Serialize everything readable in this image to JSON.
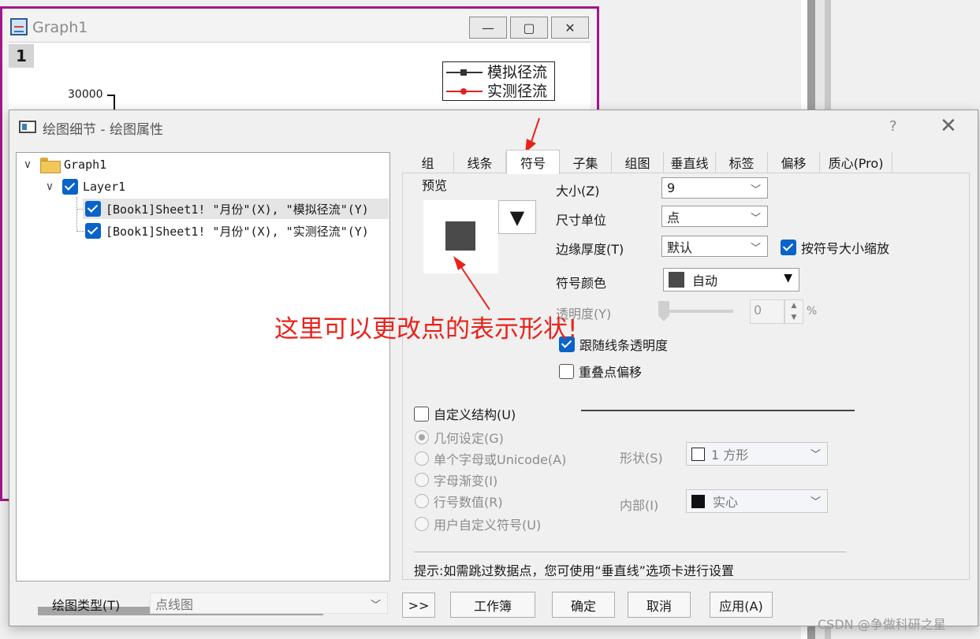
{
  "graph_window": {
    "title": "Graph1",
    "layer_badge": "1",
    "y_tick_label": "30000",
    "legend": [
      "模拟径流",
      "实测径流"
    ],
    "minimize": "—",
    "maximize": "▢",
    "close": "✕"
  },
  "dialog": {
    "title": "绘图细节 - 绘图属性",
    "help": "?",
    "close": "✕",
    "tree": {
      "graph": "Graph1",
      "layer": "Layer1",
      "series": [
        "[Book1]Sheet1! \"月份\"(X), \"模拟径流\"(Y)",
        "[Book1]Sheet1! \"月份\"(X), \"实测径流\"(Y)"
      ]
    },
    "tabs": [
      "组",
      "线条",
      "符号",
      "子集",
      "组图",
      "垂直线",
      "标签",
      "偏移",
      "质心(Pro)"
    ],
    "active_tab": "符号",
    "symbol": {
      "preview_label": "预览",
      "size_label": "大小(Z)",
      "size_value": "9",
      "unit_label": "尺寸单位",
      "unit_value": "点",
      "edge_label": "边缘厚度(T)",
      "edge_value": "默认",
      "scale_checkbox": "按符号大小缩放",
      "color_label": "符号颜色",
      "color_value": "自动",
      "transparency_label": "透明度(Y)",
      "transparency_value": "0",
      "transparency_unit": "%",
      "follow_line_checkbox": "跟随线条透明度",
      "overlap_checkbox": "重叠点偏移",
      "custom_checkbox": "自定义结构(U)",
      "radios": [
        "几何设定(G)",
        "单个字母或Unicode(A)",
        "字母渐变(I)",
        "行号数值(R)",
        "用户自定义符号(U)"
      ],
      "shape_label": "形状(S)",
      "shape_value": "1  方形",
      "interior_label": "内部(I)",
      "interior_value": "实心",
      "hint": "提示:如需跳过数据点，您可使用“垂直线”选项卡进行设置"
    },
    "footer": {
      "plot_type_label": "绘图类型(T)",
      "plot_type_value": "点线图",
      "expand": ">>",
      "workbook": "工作簿",
      "ok": "确定",
      "cancel": "取消",
      "apply": "应用(A)"
    }
  },
  "annotation": "这里可以更改点的表示形状!",
  "watermark": "CSDN @争做科研之星",
  "colors": {
    "graph_border": "#a4168a",
    "checkbox": "#0a63c8",
    "annotation": "#e8231c",
    "symbol_fill": "#4a4a4a"
  }
}
